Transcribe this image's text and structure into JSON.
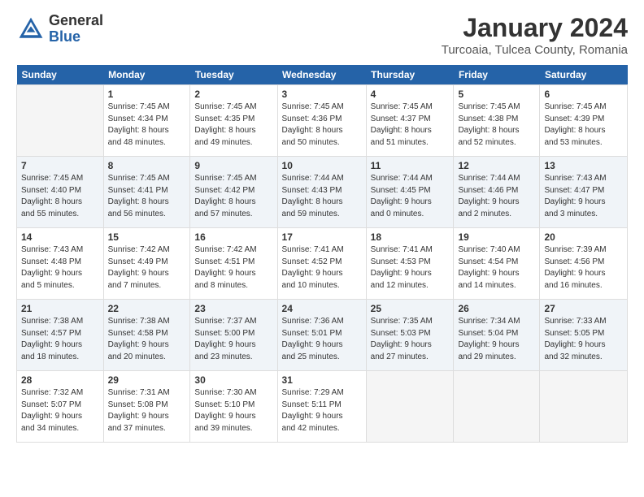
{
  "header": {
    "logo_general": "General",
    "logo_blue": "Blue",
    "month_title": "January 2024",
    "subtitle": "Turcoaia, Tulcea County, Romania"
  },
  "days_of_week": [
    "Sunday",
    "Monday",
    "Tuesday",
    "Wednesday",
    "Thursday",
    "Friday",
    "Saturday"
  ],
  "weeks": [
    [
      {
        "day": "",
        "info": ""
      },
      {
        "day": "1",
        "info": "Sunrise: 7:45 AM\nSunset: 4:34 PM\nDaylight: 8 hours\nand 48 minutes."
      },
      {
        "day": "2",
        "info": "Sunrise: 7:45 AM\nSunset: 4:35 PM\nDaylight: 8 hours\nand 49 minutes."
      },
      {
        "day": "3",
        "info": "Sunrise: 7:45 AM\nSunset: 4:36 PM\nDaylight: 8 hours\nand 50 minutes."
      },
      {
        "day": "4",
        "info": "Sunrise: 7:45 AM\nSunset: 4:37 PM\nDaylight: 8 hours\nand 51 minutes."
      },
      {
        "day": "5",
        "info": "Sunrise: 7:45 AM\nSunset: 4:38 PM\nDaylight: 8 hours\nand 52 minutes."
      },
      {
        "day": "6",
        "info": "Sunrise: 7:45 AM\nSunset: 4:39 PM\nDaylight: 8 hours\nand 53 minutes."
      }
    ],
    [
      {
        "day": "7",
        "info": "Sunrise: 7:45 AM\nSunset: 4:40 PM\nDaylight: 8 hours\nand 55 minutes."
      },
      {
        "day": "8",
        "info": "Sunrise: 7:45 AM\nSunset: 4:41 PM\nDaylight: 8 hours\nand 56 minutes."
      },
      {
        "day": "9",
        "info": "Sunrise: 7:45 AM\nSunset: 4:42 PM\nDaylight: 8 hours\nand 57 minutes."
      },
      {
        "day": "10",
        "info": "Sunrise: 7:44 AM\nSunset: 4:43 PM\nDaylight: 8 hours\nand 59 minutes."
      },
      {
        "day": "11",
        "info": "Sunrise: 7:44 AM\nSunset: 4:45 PM\nDaylight: 9 hours\nand 0 minutes."
      },
      {
        "day": "12",
        "info": "Sunrise: 7:44 AM\nSunset: 4:46 PM\nDaylight: 9 hours\nand 2 minutes."
      },
      {
        "day": "13",
        "info": "Sunrise: 7:43 AM\nSunset: 4:47 PM\nDaylight: 9 hours\nand 3 minutes."
      }
    ],
    [
      {
        "day": "14",
        "info": "Sunrise: 7:43 AM\nSunset: 4:48 PM\nDaylight: 9 hours\nand 5 minutes."
      },
      {
        "day": "15",
        "info": "Sunrise: 7:42 AM\nSunset: 4:49 PM\nDaylight: 9 hours\nand 7 minutes."
      },
      {
        "day": "16",
        "info": "Sunrise: 7:42 AM\nSunset: 4:51 PM\nDaylight: 9 hours\nand 8 minutes."
      },
      {
        "day": "17",
        "info": "Sunrise: 7:41 AM\nSunset: 4:52 PM\nDaylight: 9 hours\nand 10 minutes."
      },
      {
        "day": "18",
        "info": "Sunrise: 7:41 AM\nSunset: 4:53 PM\nDaylight: 9 hours\nand 12 minutes."
      },
      {
        "day": "19",
        "info": "Sunrise: 7:40 AM\nSunset: 4:54 PM\nDaylight: 9 hours\nand 14 minutes."
      },
      {
        "day": "20",
        "info": "Sunrise: 7:39 AM\nSunset: 4:56 PM\nDaylight: 9 hours\nand 16 minutes."
      }
    ],
    [
      {
        "day": "21",
        "info": "Sunrise: 7:38 AM\nSunset: 4:57 PM\nDaylight: 9 hours\nand 18 minutes."
      },
      {
        "day": "22",
        "info": "Sunrise: 7:38 AM\nSunset: 4:58 PM\nDaylight: 9 hours\nand 20 minutes."
      },
      {
        "day": "23",
        "info": "Sunrise: 7:37 AM\nSunset: 5:00 PM\nDaylight: 9 hours\nand 23 minutes."
      },
      {
        "day": "24",
        "info": "Sunrise: 7:36 AM\nSunset: 5:01 PM\nDaylight: 9 hours\nand 25 minutes."
      },
      {
        "day": "25",
        "info": "Sunrise: 7:35 AM\nSunset: 5:03 PM\nDaylight: 9 hours\nand 27 minutes."
      },
      {
        "day": "26",
        "info": "Sunrise: 7:34 AM\nSunset: 5:04 PM\nDaylight: 9 hours\nand 29 minutes."
      },
      {
        "day": "27",
        "info": "Sunrise: 7:33 AM\nSunset: 5:05 PM\nDaylight: 9 hours\nand 32 minutes."
      }
    ],
    [
      {
        "day": "28",
        "info": "Sunrise: 7:32 AM\nSunset: 5:07 PM\nDaylight: 9 hours\nand 34 minutes."
      },
      {
        "day": "29",
        "info": "Sunrise: 7:31 AM\nSunset: 5:08 PM\nDaylight: 9 hours\nand 37 minutes."
      },
      {
        "day": "30",
        "info": "Sunrise: 7:30 AM\nSunset: 5:10 PM\nDaylight: 9 hours\nand 39 minutes."
      },
      {
        "day": "31",
        "info": "Sunrise: 7:29 AM\nSunset: 5:11 PM\nDaylight: 9 hours\nand 42 minutes."
      },
      {
        "day": "",
        "info": ""
      },
      {
        "day": "",
        "info": ""
      },
      {
        "day": "",
        "info": ""
      }
    ]
  ]
}
